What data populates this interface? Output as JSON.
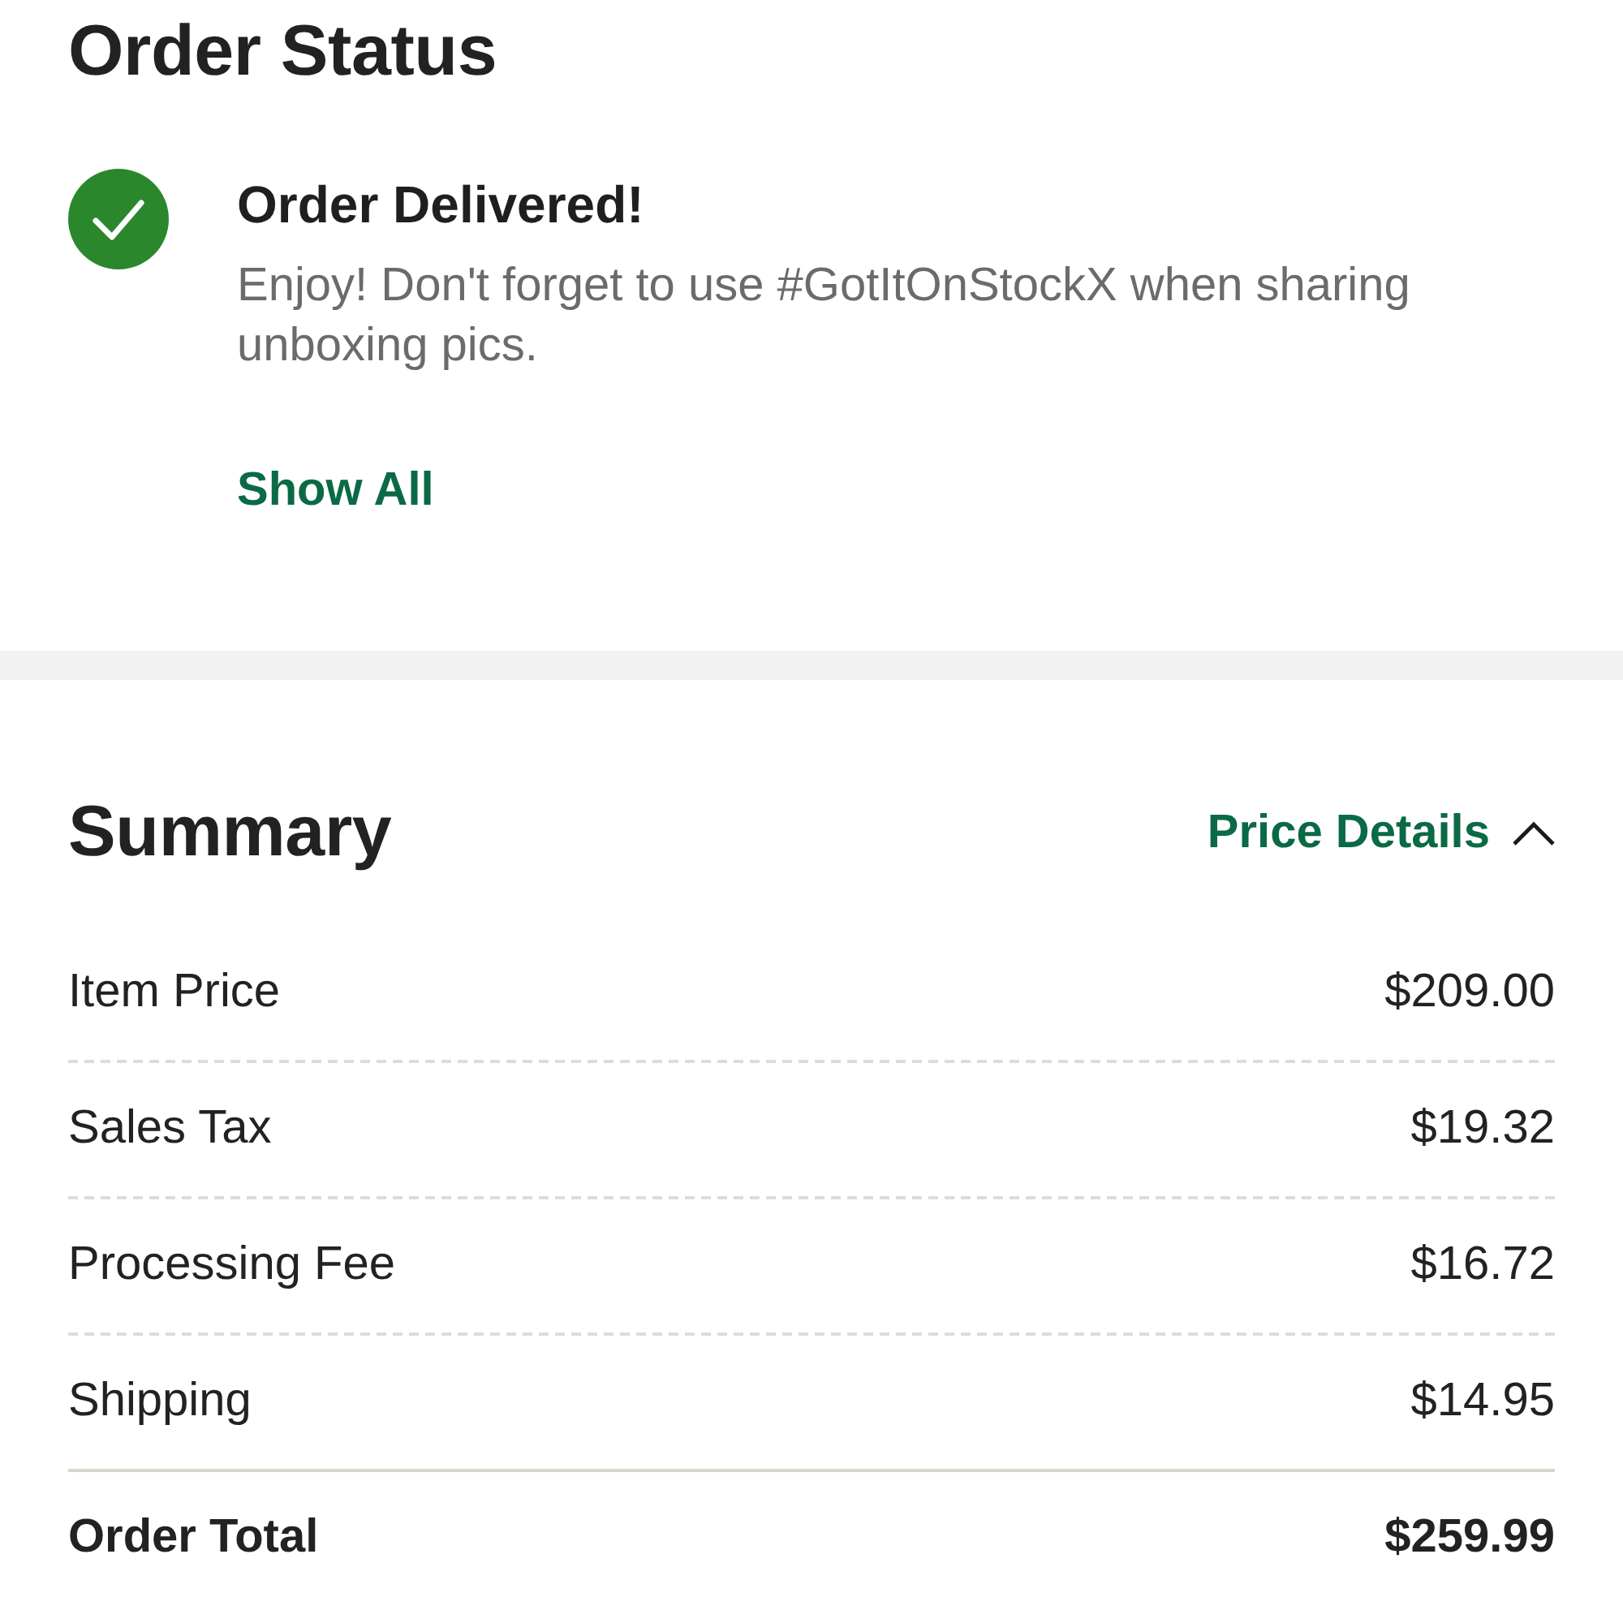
{
  "order_status": {
    "title": "Order Status",
    "status": {
      "kind": "delivered",
      "title": "Order Delivered!",
      "message": "Enjoy! Don't forget to use #GotItOnStockX when sharing unboxing pics."
    },
    "link": "Show All"
  },
  "summary": {
    "title": "Summary",
    "price_details": {
      "label": "Price Details",
      "expanded": true
    },
    "rows": [
      {
        "kind": "item",
        "label": "Item Price",
        "value": "$209.00"
      },
      {
        "kind": "item",
        "label": "Sales Tax",
        "value": "$19.32"
      },
      {
        "kind": "item",
        "label": "Processing Fee",
        "value": "$16.72"
      },
      {
        "kind": "item",
        "label": "Shipping",
        "value": "$14.95"
      },
      {
        "kind": "total",
        "label": "Order Total",
        "value": "$259.99"
      }
    ]
  }
}
